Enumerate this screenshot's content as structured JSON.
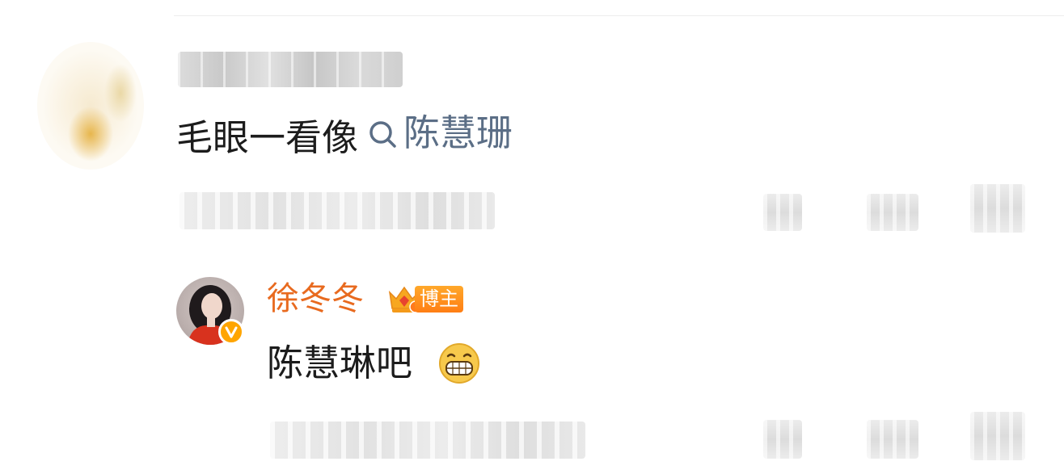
{
  "comment": {
    "text": "毛眼一看像",
    "topic": "陈慧珊",
    "topic_icon": "search-icon"
  },
  "reply": {
    "author": "徐冬冬",
    "badge": "博主",
    "crown_icon": "crown-icon",
    "verified_icon": "verified-v-icon",
    "text": "陈慧琳吧",
    "emoji": "grin-emoji"
  },
  "colors": {
    "link": "#5b6e86",
    "author_name": "#e86a1f",
    "badge_bg": "#ff8c1a",
    "verified": "#ffa500",
    "text": "#1c1c1c"
  }
}
